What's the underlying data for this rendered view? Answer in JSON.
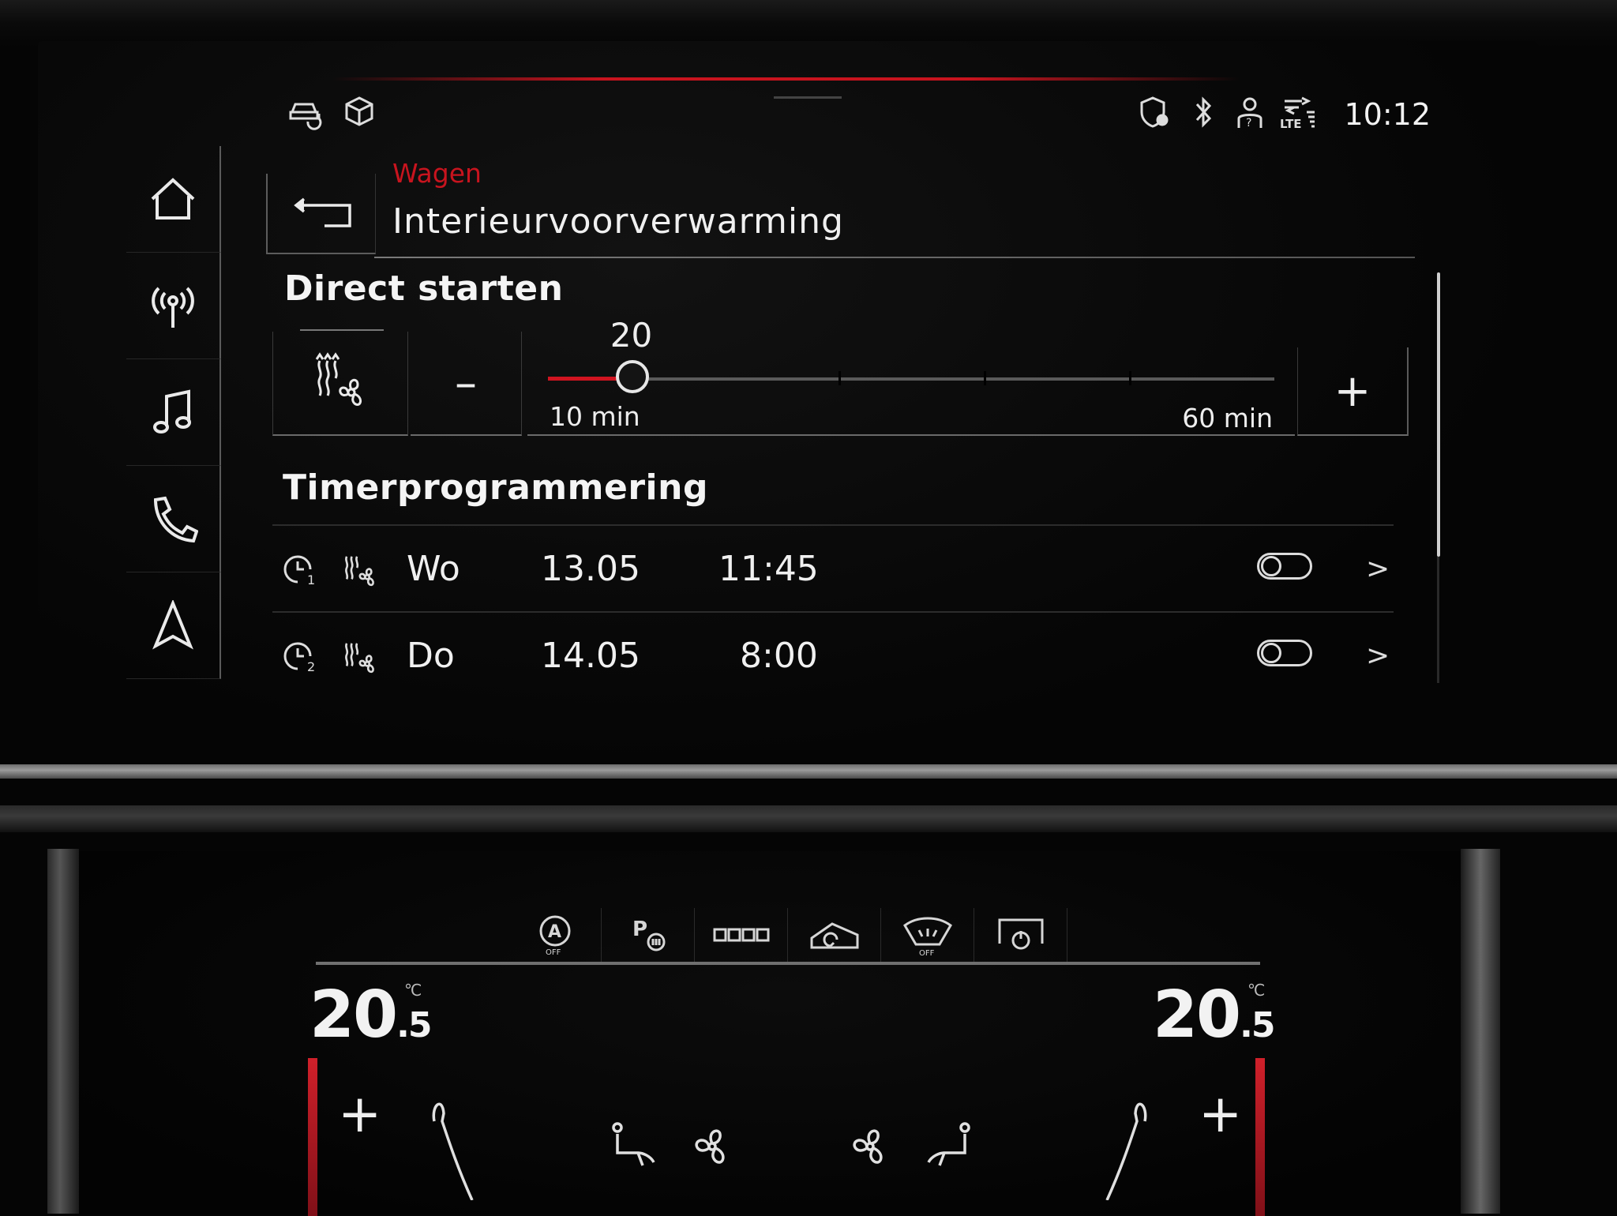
{
  "status": {
    "clock": "10:12",
    "icons": [
      "car-sync-icon",
      "cube-icon",
      "shield-location-icon",
      "bluetooth-icon",
      "user-help-icon",
      "lte-signal-icon"
    ]
  },
  "sidebar": {
    "items": [
      {
        "name": "home",
        "icon": "home-icon"
      },
      {
        "name": "radio",
        "icon": "radio-antenna-icon"
      },
      {
        "name": "media",
        "icon": "music-note-icon"
      },
      {
        "name": "phone",
        "icon": "phone-icon"
      },
      {
        "name": "navigation",
        "icon": "navigation-arrow-icon"
      }
    ]
  },
  "header": {
    "breadcrumb": "Wagen",
    "title": "Interieurvoorverwarming",
    "accent_color": "#c8141e"
  },
  "direct_start": {
    "title": "Direct starten",
    "minus_label": "–",
    "plus_label": "+",
    "slider": {
      "value": 20,
      "value_label": "20",
      "min": 10,
      "max": 60,
      "min_label": "10 min",
      "max_label": "60 min"
    }
  },
  "timer": {
    "title": "Timerprogrammering",
    "rows": [
      {
        "index": "1",
        "day": "Wo",
        "date": "13.05",
        "time": "11:45",
        "enabled": false
      },
      {
        "index": "2",
        "day": "Do",
        "date": "14.05",
        "time": "8:00",
        "enabled": false
      }
    ],
    "chevron": ">"
  },
  "climate": {
    "left_temp_int": "20",
    "left_temp_dec": "5",
    "right_temp_int": "20",
    "right_temp_dec": "5",
    "unit": "°C",
    "plus": "+",
    "buttons": [
      "auto-off-icon",
      "parking-heater-icon",
      "rear-defrost-icon",
      "recirculation-icon",
      "windshield-off-icon",
      "climate-power-icon"
    ]
  }
}
